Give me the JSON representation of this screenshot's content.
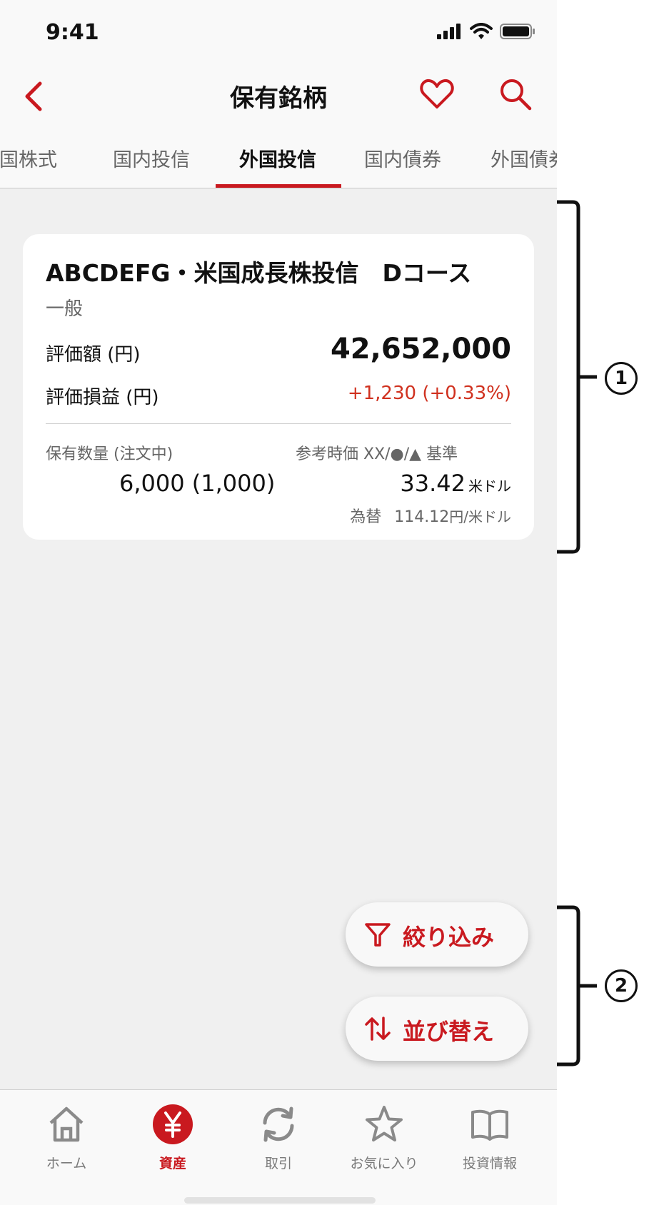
{
  "status_bar": {
    "time": "9:41"
  },
  "header": {
    "title": "保有銘柄"
  },
  "tabs": [
    {
      "label": "外国株式"
    },
    {
      "label": "国内投信"
    },
    {
      "label": "外国投信"
    },
    {
      "label": "国内債券"
    },
    {
      "label": "外国債券"
    }
  ],
  "active_tab_index": 2,
  "holding": {
    "fund_name": "ABCDEFG・米国成長株投信　Dコース",
    "account_type": "一般",
    "valuation_label": "評価額 (円)",
    "valuation_value": "42,652,000",
    "pl_label": "評価損益 (円)",
    "pl_value": "+1,230 (+0.33%)",
    "quantity_label": "保有数量 (注文中)",
    "quantity_value": "6,000 (1,000)",
    "ref_price_label": "参考時価 XX/●/▲ 基準",
    "ref_price_value": "33.42",
    "ref_price_unit": "米ドル",
    "fx_label": "為替",
    "fx_value": "114.12",
    "fx_unit": "円/米ドル"
  },
  "actions": {
    "filter_label": "絞り込み",
    "sort_label": "並び替え"
  },
  "bottom_nav": [
    {
      "label": "ホーム",
      "icon": "home-icon"
    },
    {
      "label": "資産",
      "icon": "yen-icon"
    },
    {
      "label": "取引",
      "icon": "refresh-icon"
    },
    {
      "label": "お気に入り",
      "icon": "star-icon"
    },
    {
      "label": "投資情報",
      "icon": "book-icon"
    }
  ],
  "active_nav_index": 1,
  "annotations": {
    "marker_1": "1",
    "marker_2": "2"
  },
  "colors": {
    "accent": "#c9191f",
    "profit": "#d0311f",
    "background": "#f0f0f0"
  }
}
